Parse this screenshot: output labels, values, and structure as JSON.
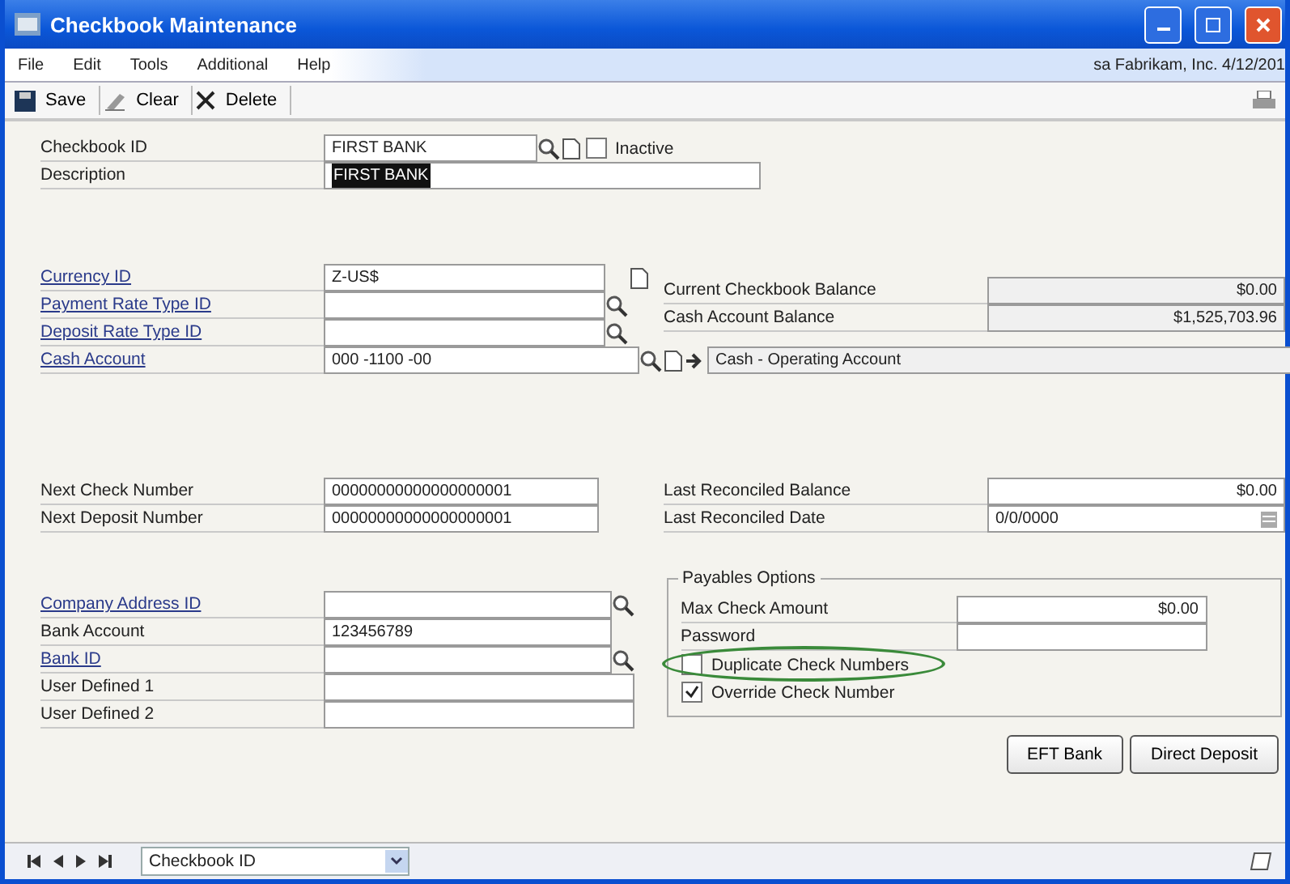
{
  "window": {
    "title": "Checkbook Maintenance"
  },
  "menu": [
    "File",
    "Edit",
    "Tools",
    "Additional",
    "Help"
  ],
  "user_info": "sa  Fabrikam, Inc.  4/12/201",
  "toolbar": [
    "Save",
    "Clear",
    "Delete"
  ],
  "header": {
    "checkbook_id": {
      "label": "Checkbook ID",
      "value": "FIRST BANK"
    },
    "inactive": {
      "label": "Inactive",
      "checked": false
    },
    "description": {
      "label": "Description",
      "value": "FIRST BANK",
      "selected": true
    }
  },
  "currency_fields": [
    {
      "label": "Currency ID",
      "value": "Z-US$",
      "link": true,
      "kind": "new"
    },
    {
      "label": "Payment Rate Type ID",
      "link": true,
      "kind": "lookup"
    },
    {
      "label": "Deposit Rate Type ID",
      "link": true,
      "kind": "lookup"
    }
  ],
  "balances": [
    {
      "label": "Current Checkbook Balance",
      "value": "$0.00"
    },
    {
      "label": "Cash Account Balance",
      "value": "$1,525,703.96"
    }
  ],
  "cash_account": {
    "label": "Cash Account",
    "value": "000 -1100 -00",
    "description": "Cash - Operating Account"
  },
  "numbers": [
    {
      "label": "Next Check Number",
      "value": "00000000000000000001"
    },
    {
      "label": "Next Deposit Number",
      "value": "00000000000000000001"
    }
  ],
  "reconcile": [
    {
      "label": "Last Reconciled Balance",
      "value": "$0.00",
      "kind": "amount"
    },
    {
      "label": "Last Reconciled Date",
      "value": "0/0/0000",
      "kind": "date"
    }
  ],
  "bank_fields": [
    {
      "label": "Company Address ID",
      "link": true,
      "kind": "lookup"
    },
    {
      "label": "Bank Account",
      "value": "123456789",
      "link": false,
      "kind": "short"
    },
    {
      "label": "Bank ID",
      "link": true,
      "kind": "lookup"
    },
    {
      "label": "User Defined 1",
      "link": false,
      "kind": "plain"
    },
    {
      "label": "User Defined 2",
      "link": false,
      "kind": "plain"
    }
  ],
  "payables": {
    "title": "Payables Options",
    "fields": [
      {
        "label": "Max Check Amount",
        "value": "$0.00",
        "kind": "amount"
      },
      {
        "label": "Password",
        "kind": "text"
      }
    ],
    "options": [
      {
        "label": "Duplicate Check Numbers",
        "checked": false,
        "highlighted": true
      },
      {
        "label": "Override Check Number",
        "checked": true,
        "highlighted": false
      }
    ]
  },
  "buttons": [
    "EFT Bank",
    "Direct Deposit"
  ],
  "browse": {
    "sort": "Checkbook ID"
  }
}
